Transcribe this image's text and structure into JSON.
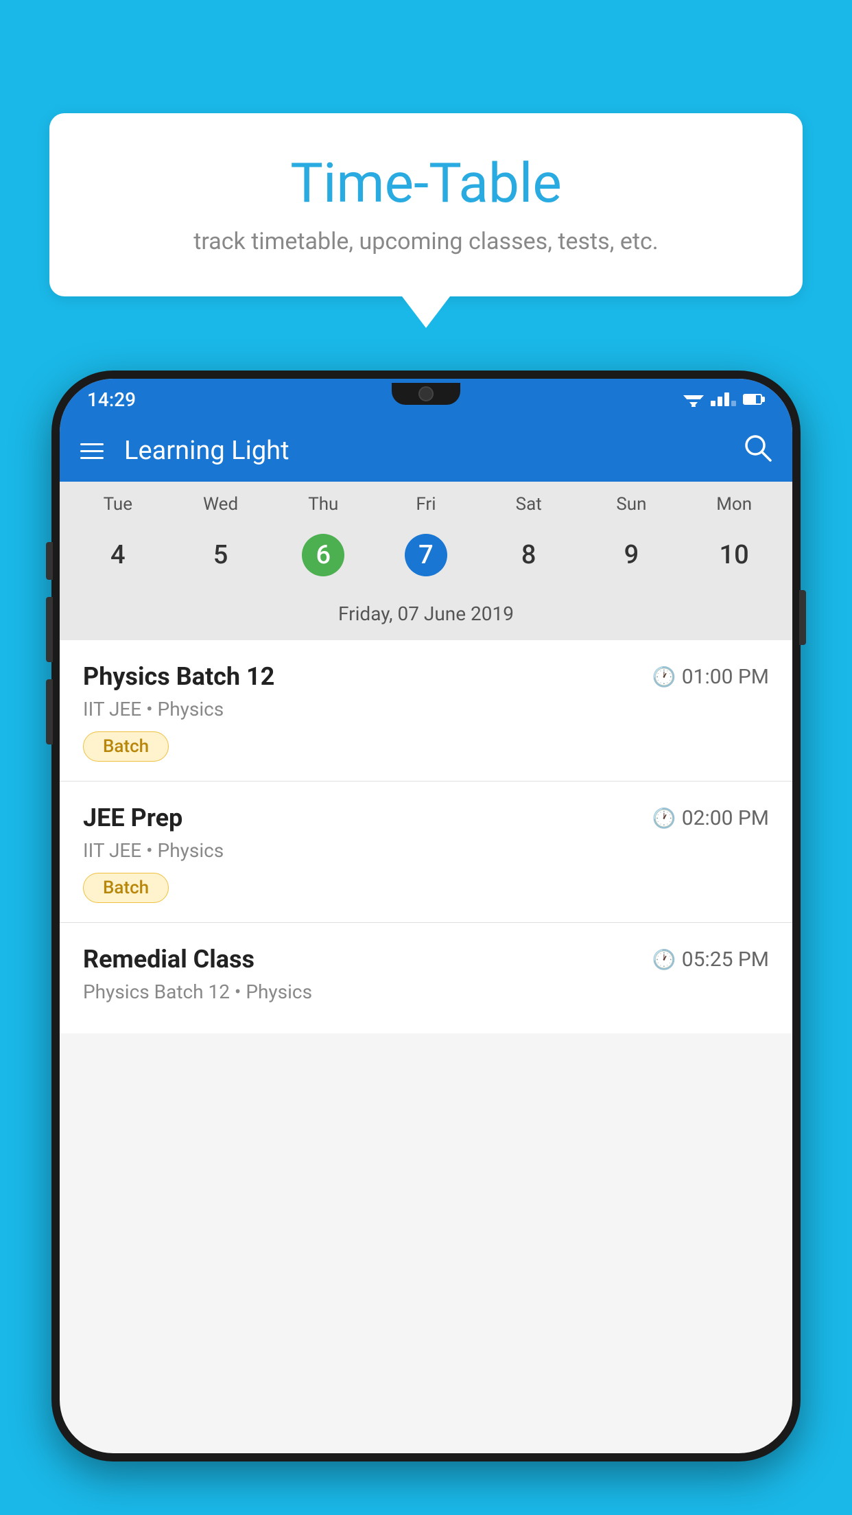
{
  "background_color": "#1ab8e8",
  "bubble": {
    "title": "Time-Table",
    "subtitle": "track timetable, upcoming classes, tests, etc."
  },
  "phone": {
    "status_bar": {
      "time": "14:29"
    },
    "app_bar": {
      "title": "Learning Light"
    },
    "calendar": {
      "days_of_week": [
        "Tue",
        "Wed",
        "Thu",
        "Fri",
        "Sat",
        "Sun",
        "Mon"
      ],
      "dates": [
        "4",
        "5",
        "6",
        "7",
        "8",
        "9",
        "10"
      ],
      "today_index": 2,
      "selected_index": 3,
      "selected_label": "Friday, 07 June 2019"
    },
    "classes": [
      {
        "name": "Physics Batch 12",
        "time": "01:00 PM",
        "meta": "IIT JEE • Physics",
        "badge": "Batch"
      },
      {
        "name": "JEE Prep",
        "time": "02:00 PM",
        "meta": "IIT JEE • Physics",
        "badge": "Batch"
      },
      {
        "name": "Remedial Class",
        "time": "05:25 PM",
        "meta": "Physics Batch 12 • Physics",
        "badge": null
      }
    ]
  }
}
